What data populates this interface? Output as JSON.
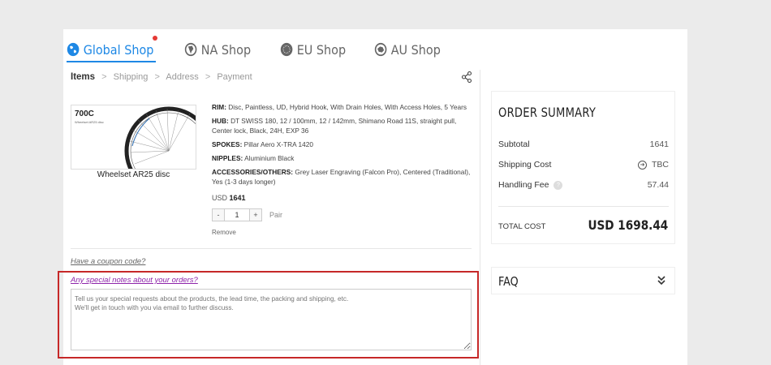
{
  "tabs": [
    {
      "label": "Global Shop",
      "icon": "globe-icon",
      "active": true
    },
    {
      "label": "NA Shop",
      "icon": "na-map-icon",
      "active": false
    },
    {
      "label": "EU Shop",
      "icon": "eu-stars-icon",
      "active": false
    },
    {
      "label": "AU Shop",
      "icon": "au-map-icon",
      "active": false
    }
  ],
  "breadcrumb": {
    "current": "Items",
    "steps": [
      "Shipping",
      "Address",
      "Payment"
    ],
    "separator": ">"
  },
  "product": {
    "image_title": "700C",
    "image_subtitle": "Wheelset AR25 disc",
    "name": "Wheelset AR25 disc",
    "specs": [
      {
        "key": "RIM:",
        "value": "Disc, Paintless, UD, Hybrid Hook, With Drain Holes, With Access Holes, 5 Years"
      },
      {
        "key": "HUB:",
        "value": "DT SWISS 180, 12 / 100mm, 12 / 142mm, Shimano Road 11S, straight pull, Center lock, Black, 24H, EXP 36"
      },
      {
        "key": "SPOKES:",
        "value": "Pillar Aero X-TRA 1420"
      },
      {
        "key": "NIPPLES:",
        "value": "Aluminium Black"
      },
      {
        "key": "ACCESSORIES/OTHERS:",
        "value": "Grey Laser Engraving (Falcon Pro), Centered (Traditional), Yes (1-3 days longer)"
      }
    ],
    "currency": "USD",
    "price": "1641",
    "qty_minus": "-",
    "qty": "1",
    "qty_plus": "+",
    "unit": "Pair",
    "remove": "Remove"
  },
  "coupon_link": "Have a coupon code?",
  "notes_link": "Any special notes about your orders?",
  "notes_placeholder": "Tell us your special requests about the products, the lead time, the packing and shipping, etc.\nWe'll get in touch with you via email to further discuss.",
  "summary": {
    "title": "ORDER SUMMARY",
    "subtotal_label": "Subtotal",
    "subtotal_value": "1641",
    "shipping_label": "Shipping Cost",
    "shipping_value": "TBC",
    "handling_label": "Handling Fee",
    "handling_help": "?",
    "handling_value": "57.44",
    "total_label": "TOTAL COST",
    "total_value": "USD 1698.44"
  },
  "faq_label": "FAQ",
  "colors": {
    "accent": "#1e88e5",
    "notification_dot": "#e53935",
    "notes_link": "#8e24aa",
    "highlight_box": "#c62828"
  }
}
